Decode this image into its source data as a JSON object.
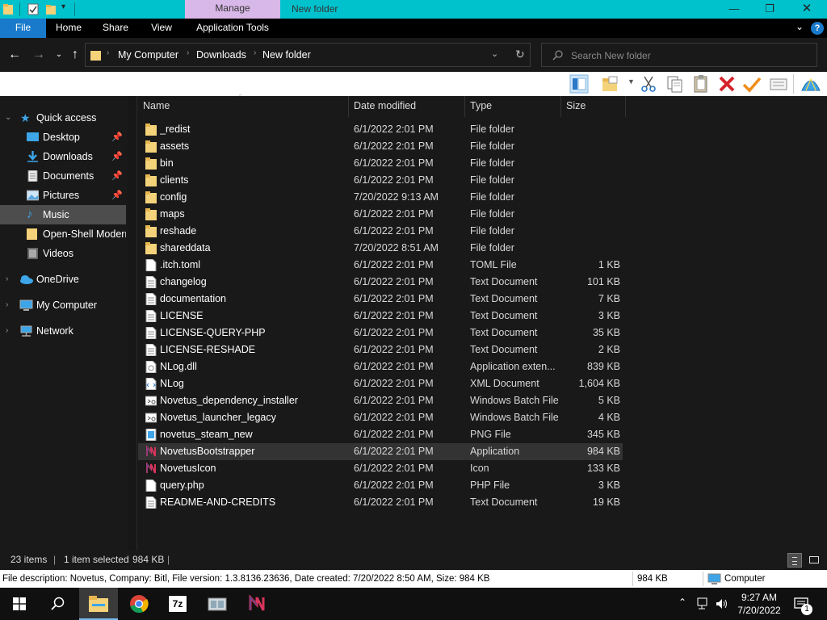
{
  "window": {
    "title": "New folder",
    "manage_tab": "Manage"
  },
  "ribbon": {
    "tabs": [
      "File",
      "Home",
      "Share",
      "View",
      "Application Tools"
    ]
  },
  "address": {
    "path": [
      "My Computer",
      "Downloads",
      "New folder"
    ],
    "search_placeholder": "Search New folder"
  },
  "nav": {
    "quick_access": "Quick access",
    "items": [
      {
        "label": "Desktop",
        "icon": "desktop-icon",
        "pinned": true
      },
      {
        "label": "Downloads",
        "icon": "downloads-icon",
        "pinned": true
      },
      {
        "label": "Documents",
        "icon": "documents-icon",
        "pinned": true
      },
      {
        "label": "Pictures",
        "icon": "pictures-icon",
        "pinned": true
      },
      {
        "label": "Music",
        "icon": "music-icon",
        "pinned": false
      },
      {
        "label": "Open-Shell Modern",
        "icon": "folder-icon",
        "pinned": false
      },
      {
        "label": "Videos",
        "icon": "videos-icon",
        "pinned": false
      }
    ],
    "onedrive": "OneDrive",
    "my_computer": "My Computer",
    "network": "Network"
  },
  "columns": {
    "name": "Name",
    "date": "Date modified",
    "type": "Type",
    "size": "Size"
  },
  "files": [
    {
      "name": "_redist",
      "date": "6/1/2022 2:01 PM",
      "type": "File folder",
      "size": "",
      "icon": "folder"
    },
    {
      "name": "assets",
      "date": "6/1/2022 2:01 PM",
      "type": "File folder",
      "size": "",
      "icon": "folder"
    },
    {
      "name": "bin",
      "date": "6/1/2022 2:01 PM",
      "type": "File folder",
      "size": "",
      "icon": "folder"
    },
    {
      "name": "clients",
      "date": "6/1/2022 2:01 PM",
      "type": "File folder",
      "size": "",
      "icon": "folder"
    },
    {
      "name": "config",
      "date": "7/20/2022 9:13 AM",
      "type": "File folder",
      "size": "",
      "icon": "folder"
    },
    {
      "name": "maps",
      "date": "6/1/2022 2:01 PM",
      "type": "File folder",
      "size": "",
      "icon": "folder"
    },
    {
      "name": "reshade",
      "date": "6/1/2022 2:01 PM",
      "type": "File folder",
      "size": "",
      "icon": "folder"
    },
    {
      "name": "shareddata",
      "date": "7/20/2022 8:51 AM",
      "type": "File folder",
      "size": "",
      "icon": "folder"
    },
    {
      "name": ".itch.toml",
      "date": "6/1/2022 2:01 PM",
      "type": "TOML File",
      "size": "1 KB",
      "icon": "doc"
    },
    {
      "name": "changelog",
      "date": "6/1/2022 2:01 PM",
      "type": "Text Document",
      "size": "101 KB",
      "icon": "text"
    },
    {
      "name": "documentation",
      "date": "6/1/2022 2:01 PM",
      "type": "Text Document",
      "size": "7 KB",
      "icon": "text"
    },
    {
      "name": "LICENSE",
      "date": "6/1/2022 2:01 PM",
      "type": "Text Document",
      "size": "3 KB",
      "icon": "text"
    },
    {
      "name": "LICENSE-QUERY-PHP",
      "date": "6/1/2022 2:01 PM",
      "type": "Text Document",
      "size": "35 KB",
      "icon": "text"
    },
    {
      "name": "LICENSE-RESHADE",
      "date": "6/1/2022 2:01 PM",
      "type": "Text Document",
      "size": "2 KB",
      "icon": "text"
    },
    {
      "name": "NLog.dll",
      "date": "6/1/2022 2:01 PM",
      "type": "Application exten...",
      "size": "839 KB",
      "icon": "dll"
    },
    {
      "name": "NLog",
      "date": "6/1/2022 2:01 PM",
      "type": "XML Document",
      "size": "1,604 KB",
      "icon": "xml"
    },
    {
      "name": "Novetus_dependency_installer",
      "date": "6/1/2022 2:01 PM",
      "type": "Windows Batch File",
      "size": "5 KB",
      "icon": "batch"
    },
    {
      "name": "Novetus_launcher_legacy",
      "date": "6/1/2022 2:01 PM",
      "type": "Windows Batch File",
      "size": "4 KB",
      "icon": "batch"
    },
    {
      "name": "novetus_steam_new",
      "date": "6/1/2022 2:01 PM",
      "type": "PNG File",
      "size": "345 KB",
      "icon": "png"
    },
    {
      "name": "NovetusBootstrapper",
      "date": "6/1/2022 2:01 PM",
      "type": "Application",
      "size": "984 KB",
      "icon": "novetus",
      "selected": true
    },
    {
      "name": "NovetusIcon",
      "date": "6/1/2022 2:01 PM",
      "type": "Icon",
      "size": "133 KB",
      "icon": "novetus"
    },
    {
      "name": "query.php",
      "date": "6/1/2022 2:01 PM",
      "type": "PHP File",
      "size": "3 KB",
      "icon": "doc"
    },
    {
      "name": "README-AND-CREDITS",
      "date": "6/1/2022 2:01 PM",
      "type": "Text Document",
      "size": "19 KB",
      "icon": "text"
    }
  ],
  "status": {
    "count": "23 items",
    "selection": "1 item selected",
    "selection_size": "984 KB"
  },
  "description": {
    "text": "File description: Novetus, Company: Bitl, File version: 1.3.8136.23636, Date created: 7/20/2022 8:50 AM, Size: 984 KB",
    "size": "984 KB",
    "location": "Computer"
  },
  "taskbar": {
    "time": "9:27 AM",
    "date": "7/20/2022",
    "notification_count": "1",
    "apps": [
      "file-explorer-icon",
      "chrome-icon",
      "7zip-icon",
      "app-icon",
      "novetus-icon"
    ]
  },
  "colors": {
    "title_bar": "#00c2cd",
    "manage_tab": "#d8b8e8",
    "file_tab": "#1979ca",
    "folder": "#f3d27a",
    "selection": "#333333"
  }
}
